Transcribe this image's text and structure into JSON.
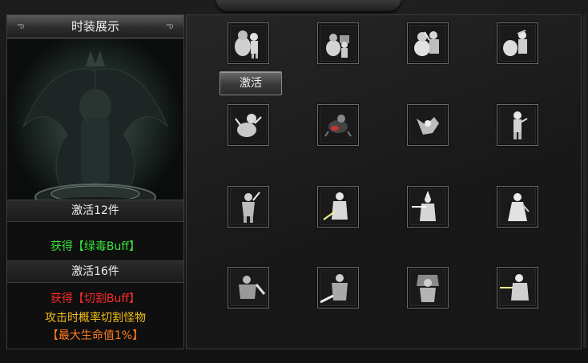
{
  "header": {
    "banner_text": ""
  },
  "panel": {
    "title": "时装展示",
    "activate12": "激活12件",
    "buff12": "获得【绿毒Buff】",
    "activate16": "激活16件",
    "buff16": "获得【切割Buff】",
    "buff16_desc": "攻击时概率切割怪物",
    "buff16_value": "【最大生命值1%】"
  },
  "button": {
    "activate_label": "激活"
  },
  "slots": [
    {
      "icon": "gourd-figure-icon"
    },
    {
      "icon": "gourd-figure-icon"
    },
    {
      "icon": "gourd-figure-icon"
    },
    {
      "icon": "gourd-figure-icon"
    },
    {
      "icon": "creature-figure-icon"
    },
    {
      "icon": "creature-figure-icon"
    },
    {
      "icon": "creature-figure-icon"
    },
    {
      "icon": "creature-figure-icon"
    },
    {
      "icon": "warrior-figure-icon"
    },
    {
      "icon": "warrior-figure-icon"
    },
    {
      "icon": "warrior-figure-icon"
    },
    {
      "icon": "warrior-figure-icon"
    },
    {
      "icon": "armored-figure-icon"
    },
    {
      "icon": "armored-figure-icon"
    },
    {
      "icon": "armored-figure-icon"
    },
    {
      "icon": "armored-figure-icon"
    }
  ]
}
